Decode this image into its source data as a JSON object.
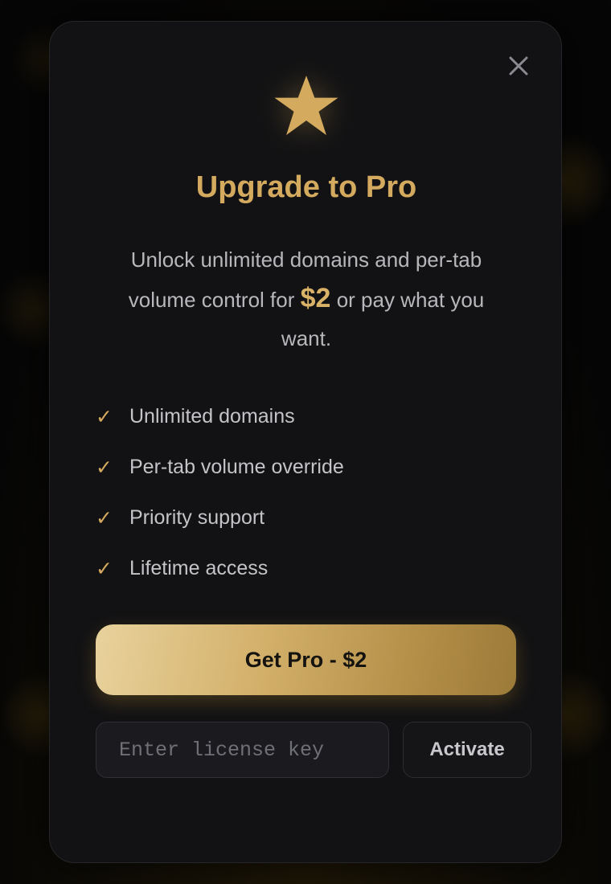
{
  "modal": {
    "title": "Upgrade to Pro",
    "description_before": "Unlock unlimited domains and per-tab volume control for",
    "price": "$2",
    "description_after": "or pay what you want.",
    "features": [
      {
        "check": "✓",
        "label": "Unlimited domains"
      },
      {
        "check": "✓",
        "label": "Per-tab volume override"
      },
      {
        "check": "✓",
        "label": "Priority support"
      },
      {
        "check": "✓",
        "label": "Lifetime access"
      }
    ],
    "cta_label": "Get Pro - $2",
    "license_placeholder": "Enter license key",
    "activate_label": "Activate",
    "icons": {
      "header": "star-icon",
      "close": "close-icon"
    }
  },
  "colors": {
    "accent_gold": "#d4aa5f",
    "modal_background": "#121214",
    "page_background": "#060606"
  }
}
